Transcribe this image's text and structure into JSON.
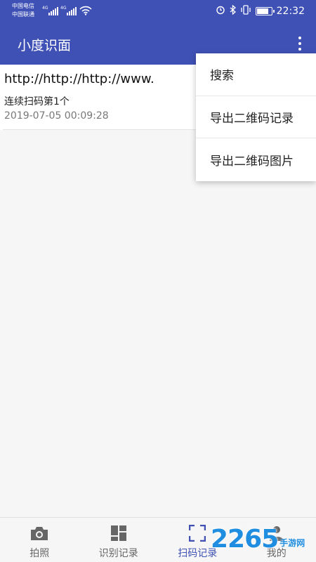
{
  "status_bar": {
    "carrier_1": "中国电信",
    "carrier_2": "中国联通",
    "net_1": "4G",
    "net_2": "4G",
    "time": "22:32",
    "battery_level": 0.85
  },
  "app_bar": {
    "title": "小度识面",
    "more_icon": "more-vert-icon"
  },
  "records": [
    {
      "content": "http://http://http://www.",
      "type": "连续扫码第1个",
      "time": "2019-07-05 00:09:28"
    }
  ],
  "menu": {
    "items": [
      "搜索",
      "导出二维码记录",
      "导出二维码图片"
    ]
  },
  "bottom_nav": {
    "items": [
      {
        "label": "拍照",
        "icon": "camera-icon"
      },
      {
        "label": "识别记录",
        "icon": "dashboard-icon"
      },
      {
        "label": "扫码记录",
        "icon": "scan-frame-icon"
      },
      {
        "label": "我的",
        "icon": "person-icon"
      }
    ],
    "active_index": 2
  },
  "watermark": {
    "number": "2265",
    "text": "手游网"
  },
  "colors": {
    "primary": "#3f51b5",
    "background": "#f6f6f6",
    "watermark": "#1f8de0"
  }
}
